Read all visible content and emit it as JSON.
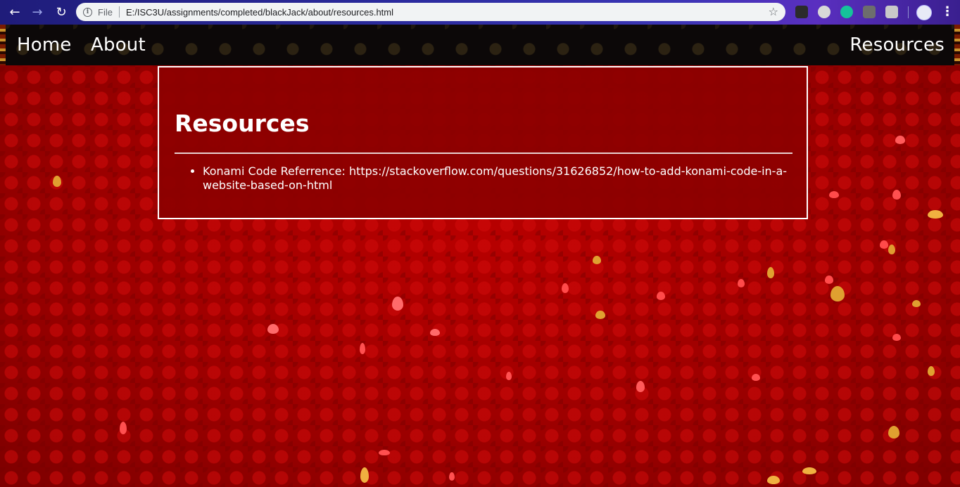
{
  "browser": {
    "back_icon": "←",
    "forward_icon": "→",
    "reload_icon": "↻",
    "info_icon": "i",
    "scheme_label": "File",
    "url": "E:/ISC3U/assignments/completed/blackJack/about/resources.html",
    "bookmark_icon": "☆",
    "menu_icon": "⋮"
  },
  "nav": {
    "home": "Home",
    "about": "About",
    "resources": "Resources"
  },
  "content": {
    "title": "Resources",
    "items": [
      "Konami Code Referrence: https://stackoverflow.com/questions/31626852/how-to-add-konami-code-in-a-website-based-on-html"
    ]
  },
  "colors": {
    "page_background": "#a80000",
    "panel_background": "#8c0000",
    "nav_background": "#0c0808",
    "text": "#ffffff"
  }
}
